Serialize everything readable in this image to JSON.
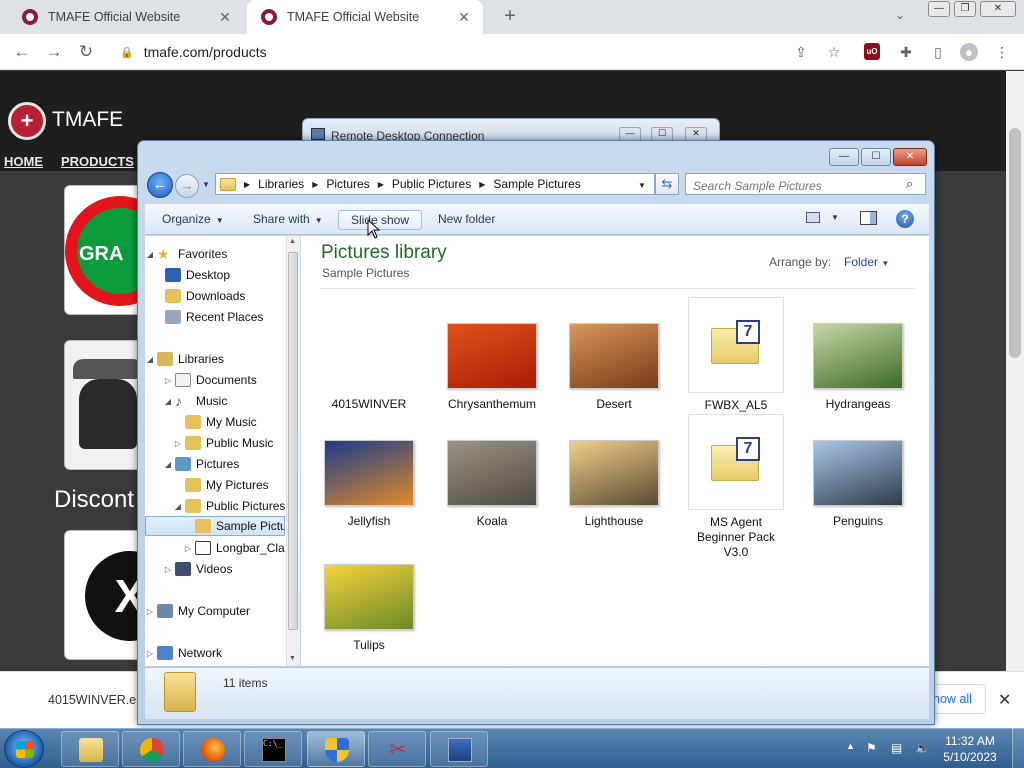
{
  "browser": {
    "tabs": [
      {
        "title": "TMAFE Official Website"
      },
      {
        "title": "TMAFE Official Website"
      }
    ],
    "address": "tmafe.com/products"
  },
  "website": {
    "brand": "TMAFE",
    "nav": [
      "HOME",
      "PRODUCTS"
    ],
    "card1_text": "GRA",
    "discontinued_fragment": "Discont"
  },
  "download_bar": {
    "file_name": "4015WINVER.e",
    "show_all": "how all"
  },
  "rdc_window": {
    "title": "Remote Desktop Connection"
  },
  "explorer": {
    "breadcrumb": [
      "Libraries",
      "Pictures",
      "Public Pictures",
      "Sample Pictures"
    ],
    "search_placeholder": "Search Sample Pictures",
    "commands": {
      "organize": "Organize",
      "share_with": "Share with",
      "slide_show": "Slide show",
      "new_folder": "New folder"
    },
    "nav_pane": [
      {
        "label": "Favorites"
      },
      {
        "label": "Desktop"
      },
      {
        "label": "Downloads"
      },
      {
        "label": "Recent Places"
      },
      {
        "label": "Libraries"
      },
      {
        "label": "Documents"
      },
      {
        "label": "Music"
      },
      {
        "label": "My Music"
      },
      {
        "label": "Public Music"
      },
      {
        "label": "Pictures"
      },
      {
        "label": "My Pictures"
      },
      {
        "label": "Public Pictures"
      },
      {
        "label": "Sample Pictu"
      },
      {
        "label": "Longbar_Clas"
      },
      {
        "label": "Videos"
      },
      {
        "label": "My Computer"
      },
      {
        "label": "Network"
      }
    ],
    "library_title": "Pictures library",
    "library_subtitle": "Sample Pictures",
    "arrange_label": "Arrange by:",
    "arrange_value": "Folder",
    "items": [
      {
        "label": "4015WINVER",
        "kind": "blank"
      },
      {
        "label": "Chrysanthemum",
        "kind": "photo",
        "colors": [
          "#e0521b",
          "#a81d05"
        ]
      },
      {
        "label": "Desert",
        "kind": "photo",
        "colors": [
          "#d8955c",
          "#7a3b16"
        ]
      },
      {
        "label": "FWBX_AL5",
        "kind": "archive"
      },
      {
        "label": "Hydrangeas",
        "kind": "photo",
        "colors": [
          "#c9d6a6",
          "#3c6a2a"
        ]
      },
      {
        "label": "Jellyfish",
        "kind": "photo",
        "colors": [
          "#1a3b8a",
          "#e08a2a"
        ]
      },
      {
        "label": "Koala",
        "kind": "photo",
        "colors": [
          "#9a9286",
          "#4f4b44"
        ]
      },
      {
        "label": "Lighthouse",
        "kind": "photo",
        "colors": [
          "#f0d08a",
          "#5a4a32"
        ]
      },
      {
        "label": "MS Agent Beginner Pack V3.0",
        "kind": "archive"
      },
      {
        "label": "Penguins",
        "kind": "photo",
        "colors": [
          "#a9c7e8",
          "#2e3b4a"
        ]
      },
      {
        "label": "Tulips",
        "kind": "photo",
        "colors": [
          "#f6d33a",
          "#6a8a2a"
        ]
      }
    ],
    "item_count": "11 items"
  },
  "taskbar": {
    "time": "11:32 AM",
    "date": "5/10/2023"
  }
}
